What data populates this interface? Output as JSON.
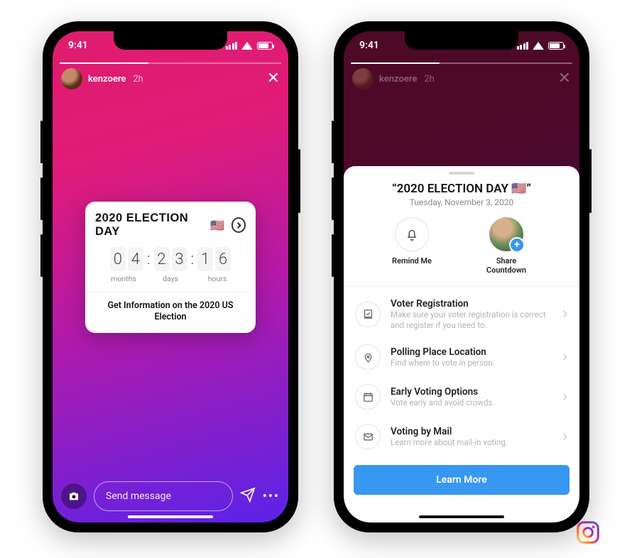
{
  "status": {
    "time": "9:41"
  },
  "story": {
    "username": "kenzoere",
    "age": "2h",
    "reply_placeholder": "Send message"
  },
  "countdown": {
    "title": "2020 ELECTION DAY",
    "flag": "🇺🇸",
    "digits": {
      "m1": "0",
      "m2": "4",
      "d1": "2",
      "d2": "3",
      "h1": "1",
      "h2": "6"
    },
    "unit_months": "months",
    "unit_days": "days",
    "unit_hours": "hours",
    "cta": "Get Information on the 2020 US Election"
  },
  "sheet": {
    "title": "“2020 ELECTION DAY 🇺🇸”",
    "date": "Tuesday, November 3, 2020",
    "remind_label": "Remind Me",
    "share_label": "Share Countdown",
    "items": [
      {
        "title": "Voter Registration",
        "desc": "Make sure your voter registration is correct and register if you need to."
      },
      {
        "title": "Polling Place Location",
        "desc": "Find where to vote in person."
      },
      {
        "title": "Early Voting Options",
        "desc": "Vote early and avoid crowds."
      },
      {
        "title": "Voting by Mail",
        "desc": "Learn more about mail-in voting."
      }
    ],
    "learn_more": "Learn More"
  }
}
